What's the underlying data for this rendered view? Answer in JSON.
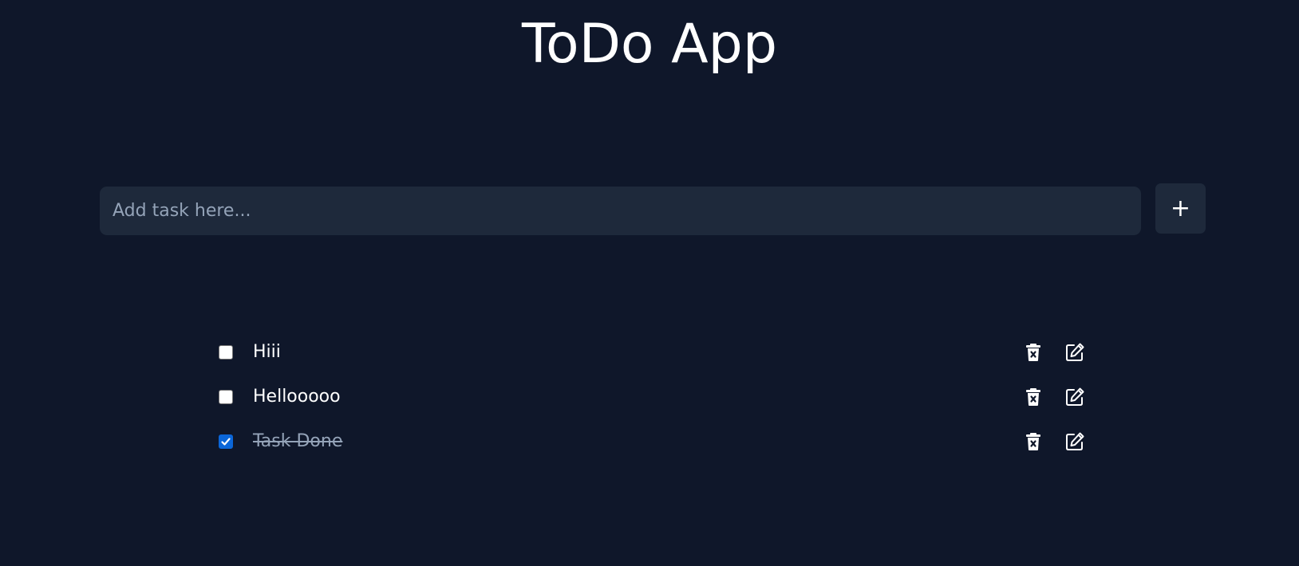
{
  "app": {
    "title": "ToDo App"
  },
  "add_task": {
    "placeholder": "Add task here...",
    "value": "",
    "add_button_label": "+"
  },
  "tasks": [
    {
      "text": "Hiii",
      "done": false
    },
    {
      "text": "Hellooooo",
      "done": false
    },
    {
      "text": "Task Done",
      "done": true
    }
  ],
  "icons": {
    "delete": "trash-x-icon",
    "edit": "pencil-edit-icon"
  },
  "colors": {
    "background": "#0f172a",
    "input_background": "#1e293b",
    "text": "#ffffff",
    "muted_text": "#94a3b8",
    "checkbox_checked": "#0b66d8"
  }
}
